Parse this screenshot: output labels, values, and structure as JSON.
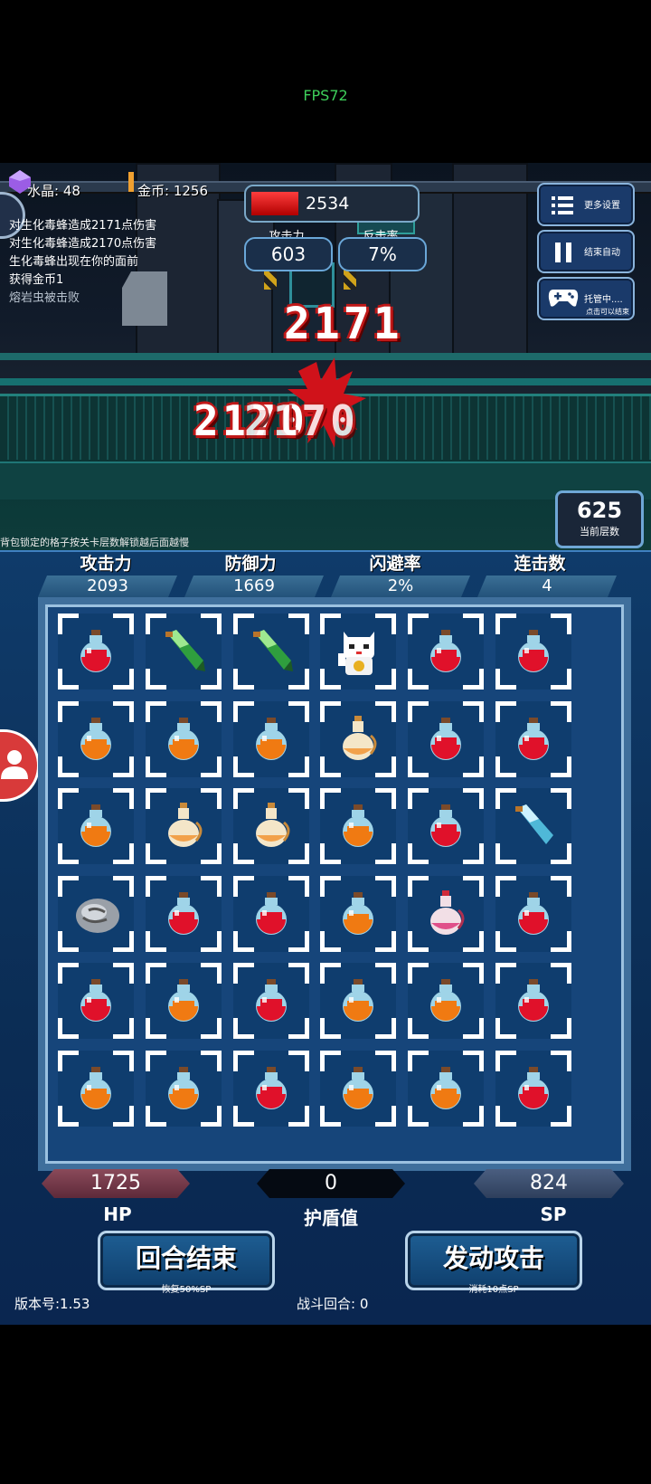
{
  "fps": "FPS72",
  "hud": {
    "crystal_label": "水晶: 48",
    "coin_label": "金币: 1256",
    "enemy_hp": "2534",
    "attack_label": "攻击力",
    "attack_value": "603",
    "counter_label": "反击率",
    "counter_value": "7%"
  },
  "side_buttons": {
    "more_settings": "更多设置",
    "end_auto": "结束自动",
    "auto_play": "托管中....",
    "auto_play_sub": "点击可以结束"
  },
  "log": [
    "对生化毒蜂造成2171点伤害",
    "对生化毒蜂造成2170点伤害",
    "生化毒蜂出现在你的面前",
    "获得金币1",
    "熔岩虫被击败"
  ],
  "damage_numbers": [
    "2171",
    "2170",
    "2170"
  ],
  "floor": {
    "value": "625",
    "label": "当前层数"
  },
  "lock_tip": "背包锁定的格子按关卡层数解锁越后面越慢",
  "stats": [
    {
      "label": "攻击力",
      "value": "2093"
    },
    {
      "label": "防御力",
      "value": "1669"
    },
    {
      "label": "闪避率",
      "value": "2%"
    },
    {
      "label": "连击数",
      "value": "4"
    }
  ],
  "grid": [
    [
      [
        "purple",
        "red"
      ],
      [
        "orange",
        "green"
      ],
      [
        "orange",
        "green"
      ],
      [
        "yellow",
        "cat"
      ],
      [
        "purple",
        "red"
      ],
      [
        "purple",
        "red"
      ]
    ],
    [
      [
        "purple",
        "orange"
      ],
      [
        "purple",
        "orange"
      ],
      [
        "purple",
        "orange"
      ],
      [
        "orange",
        "jug"
      ],
      [
        "purple",
        "red"
      ],
      [
        "purple",
        "red"
      ]
    ],
    [
      [
        "purple",
        "orange"
      ],
      [
        "orange",
        "jug"
      ],
      [
        "orange",
        "jug"
      ],
      [
        "purple",
        "orange"
      ],
      [
        "purple",
        "red"
      ],
      [
        "orange",
        "cyan"
      ]
    ],
    [
      [
        "orange",
        "stone"
      ],
      [
        "purple",
        "red"
      ],
      [
        "purple",
        "red"
      ],
      [
        "purple",
        "orange"
      ],
      [
        "orange",
        "pinkjug"
      ],
      [
        "purple",
        "red"
      ]
    ],
    [
      [
        "purple",
        "red"
      ],
      [
        "purple",
        "orange"
      ],
      [
        "purple",
        "red"
      ],
      [
        "purple",
        "orange"
      ],
      [
        "purple",
        "orange"
      ],
      [
        "purple",
        "red"
      ]
    ],
    [
      [
        "purple",
        "orange"
      ],
      [
        "purple",
        "orange"
      ],
      [
        "purple",
        "red"
      ],
      [
        "purple",
        "orange"
      ],
      [
        "purple",
        "orange"
      ],
      [
        "purple",
        "red"
      ]
    ]
  ],
  "bottom": {
    "hp_value": "1725",
    "shield_value": "0",
    "sp_value": "824",
    "hp_label": "HP",
    "shield_label": "护盾值",
    "sp_label": "SP",
    "end_turn": "回合结束",
    "end_turn_sub": "恢复50%SP",
    "attack": "发动攻击",
    "attack_sub": "消耗10点SP",
    "version": "版本号:1.53",
    "round": "战斗回合: 0"
  },
  "colors": {
    "hp_red": "#c81f1f",
    "panel_blue": "#0f3b6a",
    "fps_green": "#3ecf5a"
  }
}
